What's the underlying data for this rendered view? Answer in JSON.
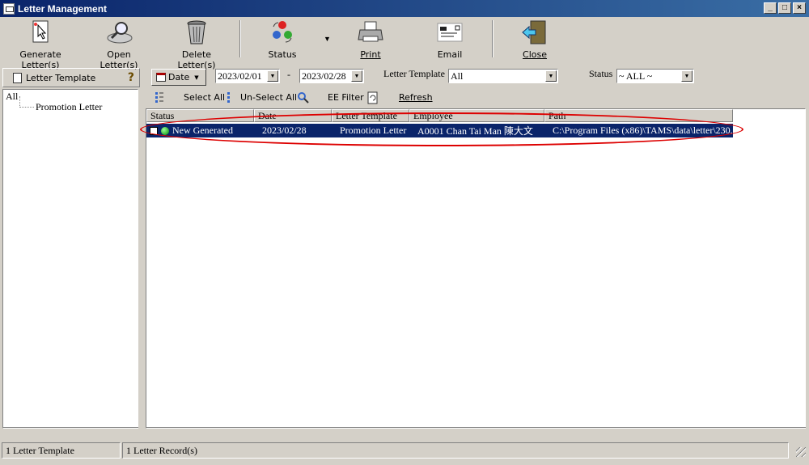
{
  "window": {
    "title": "Letter Management"
  },
  "toolbar": {
    "generate": "Generate Letter(s)",
    "open": "Open Letter(s)",
    "delete": "Delete Letter(s)",
    "status": "Status",
    "print": "Print",
    "email": "Email",
    "close": "Close"
  },
  "left_panel": {
    "header": "Letter Template",
    "tree": {
      "root": "All",
      "child": "Promotion Letter"
    }
  },
  "filter": {
    "date_button": "Date",
    "date_from": "2023/02/01",
    "date_separator": "-",
    "date_to": "2023/02/28",
    "template_label": "Letter Template",
    "template_value": "All",
    "status_label": "Status",
    "status_value": "~ ALL ~"
  },
  "actions": {
    "select_all": "Select All",
    "unselect_all": "Un-Select All",
    "ee_filter": "EE Filter",
    "refresh": "Refresh"
  },
  "grid": {
    "columns": [
      "Status",
      "Date",
      "Letter Template",
      "Employee",
      "Path"
    ],
    "rows": [
      {
        "status": "New Generated",
        "date": "2023/02/28",
        "template": "Promotion Letter",
        "employee": "A0001 Chan Tai Man 陳大文",
        "path": "C:\\Program Files (x86)\\TAMS\\data\\letter\\230..."
      }
    ]
  },
  "statusbar": {
    "templates": "1 Letter Template",
    "records": "1 Letter Record(s)"
  }
}
